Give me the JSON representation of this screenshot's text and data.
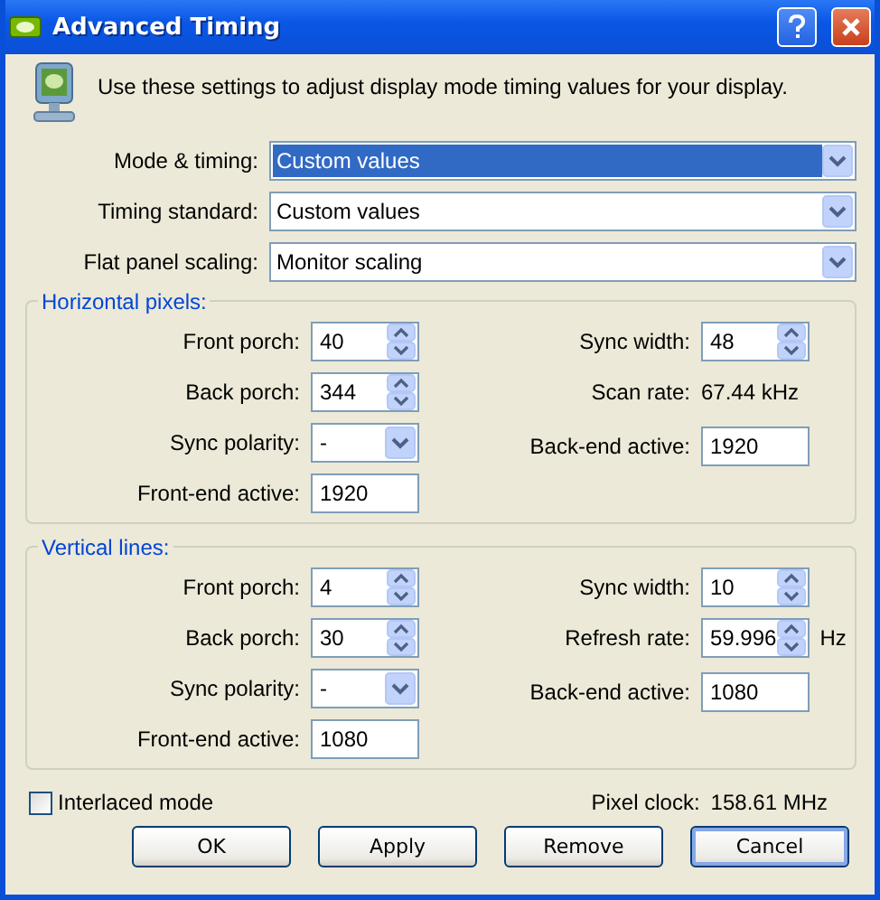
{
  "window": {
    "title": "Advanced Timing"
  },
  "intro": "Use these settings to adjust display mode timing values for your display.",
  "settings": [
    {
      "label": "Mode & timing:",
      "value": "Custom values",
      "selected": true
    },
    {
      "label": "Timing standard:",
      "value": "Custom values",
      "selected": false
    },
    {
      "label": "Flat panel scaling:",
      "value": "Monitor scaling",
      "selected": false
    }
  ],
  "groups": [
    {
      "title": "Horizontal pixels:",
      "left": [
        {
          "kind": "spin",
          "label": "Front porch:",
          "value": "40"
        },
        {
          "kind": "spin",
          "label": "Back porch:",
          "value": "344"
        },
        {
          "kind": "dropdown",
          "label": "Sync polarity:",
          "value": "-"
        },
        {
          "kind": "text",
          "label": "Front-end active:",
          "value": "1920"
        }
      ],
      "right": [
        {
          "kind": "spin",
          "label": "Sync width:",
          "value": "48"
        },
        {
          "kind": "readout",
          "label": "Scan rate:",
          "value": "67.44 kHz"
        },
        {
          "kind": "text",
          "label": "Back-end active:",
          "value": "1920"
        }
      ]
    },
    {
      "title": "Vertical lines:",
      "left": [
        {
          "kind": "spin",
          "label": "Front porch:",
          "value": "4"
        },
        {
          "kind": "spin",
          "label": "Back porch:",
          "value": "30"
        },
        {
          "kind": "dropdown",
          "label": "Sync polarity:",
          "value": "-"
        },
        {
          "kind": "text",
          "label": "Front-end active:",
          "value": "1080"
        }
      ],
      "right": [
        {
          "kind": "spin",
          "label": "Sync width:",
          "value": "10"
        },
        {
          "kind": "spin",
          "label": "Refresh rate:",
          "value": "59.996",
          "unit": "Hz"
        },
        {
          "kind": "text",
          "label": "Back-end active:",
          "value": "1080"
        }
      ]
    }
  ],
  "interlaced": {
    "label": "Interlaced mode",
    "checked": false
  },
  "pixel_clock": {
    "label": "Pixel clock:",
    "value": "158.61 MHz"
  },
  "buttons": [
    {
      "label": "OK",
      "default": false
    },
    {
      "label": "Apply",
      "default": false
    },
    {
      "label": "Remove",
      "default": false
    },
    {
      "label": "Cancel",
      "default": true
    }
  ]
}
